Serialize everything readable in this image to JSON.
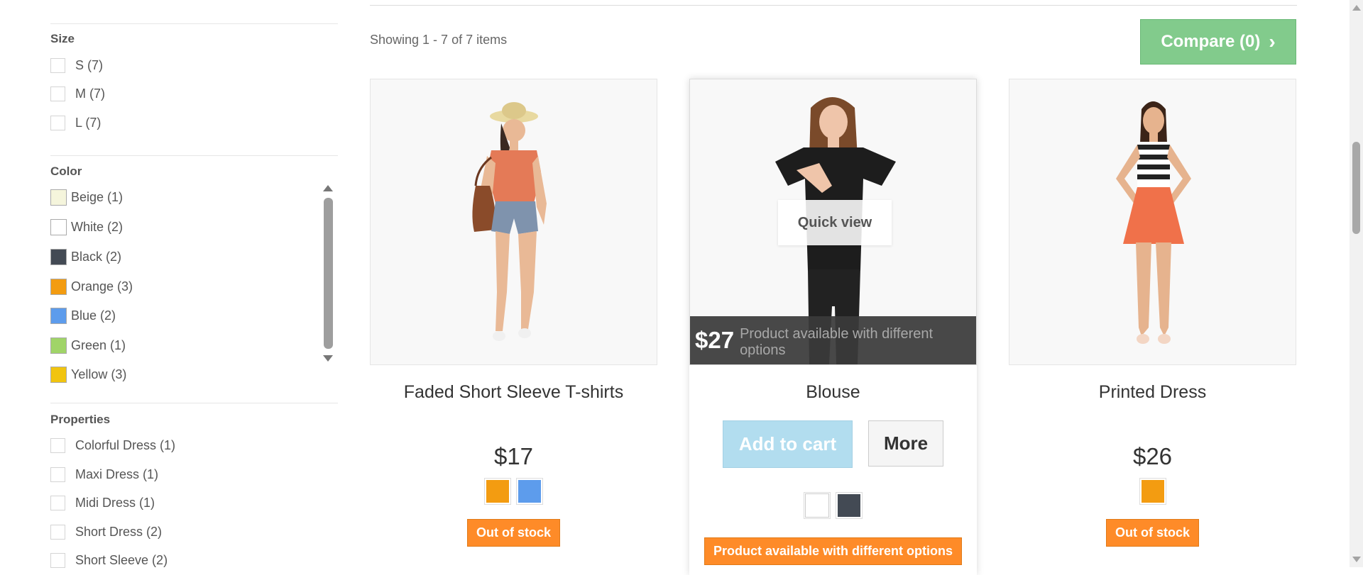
{
  "filters": {
    "size": {
      "title": "Size",
      "options": [
        {
          "label": "S (7)"
        },
        {
          "label": "M (7)"
        },
        {
          "label": "L (7)"
        }
      ]
    },
    "color": {
      "title": "Color",
      "options": [
        {
          "label": "Beige (1)",
          "color": "#f5f5dc"
        },
        {
          "label": "White (2)",
          "color": "#ffffff"
        },
        {
          "label": "Black (2)",
          "color": "#434a54"
        },
        {
          "label": "Orange (3)",
          "color": "#f39c11"
        },
        {
          "label": "Blue (2)",
          "color": "#5d9cec"
        },
        {
          "label": "Green (1)",
          "color": "#a0d468"
        },
        {
          "label": "Yellow (3)",
          "color": "#f1c40f"
        }
      ]
    },
    "properties": {
      "title": "Properties",
      "options": [
        {
          "label": "Colorful Dress (1)"
        },
        {
          "label": "Maxi Dress (1)"
        },
        {
          "label": "Midi Dress (1)"
        },
        {
          "label": "Short Dress (2)"
        },
        {
          "label": "Short Sleeve (2)"
        }
      ]
    }
  },
  "listing": {
    "count_text": "Showing 1 - 7 of 7 items",
    "compare_label": "Compare (0)"
  },
  "products": [
    {
      "name": "Faded Short Sleeve T-shirts",
      "price": "$17",
      "swatches": [
        "#f39c11",
        "#5d9cec"
      ],
      "badge": "Out of stock",
      "image": "woman-in-straw-hat-and-denim-shorts"
    },
    {
      "name": "Blouse",
      "price": "$27",
      "price_note": "Product available with different options",
      "quick_view": "Quick view",
      "add_to_cart": "Add to cart",
      "more": "More",
      "swatches": [
        "#ffffff",
        "#434a54"
      ],
      "badge": "Product available with different options",
      "image": "woman-in-black-blouse"
    },
    {
      "name": "Printed Dress",
      "price": "$26",
      "swatches": [
        "#f39c11"
      ],
      "badge": "Out of stock",
      "image": "woman-in-striped-top-and-orange-skirt"
    }
  ],
  "colors": {
    "badge_orange": "#fe8b28",
    "compare_green": "#82cb8c",
    "cart_blue": "#b2ddef"
  }
}
